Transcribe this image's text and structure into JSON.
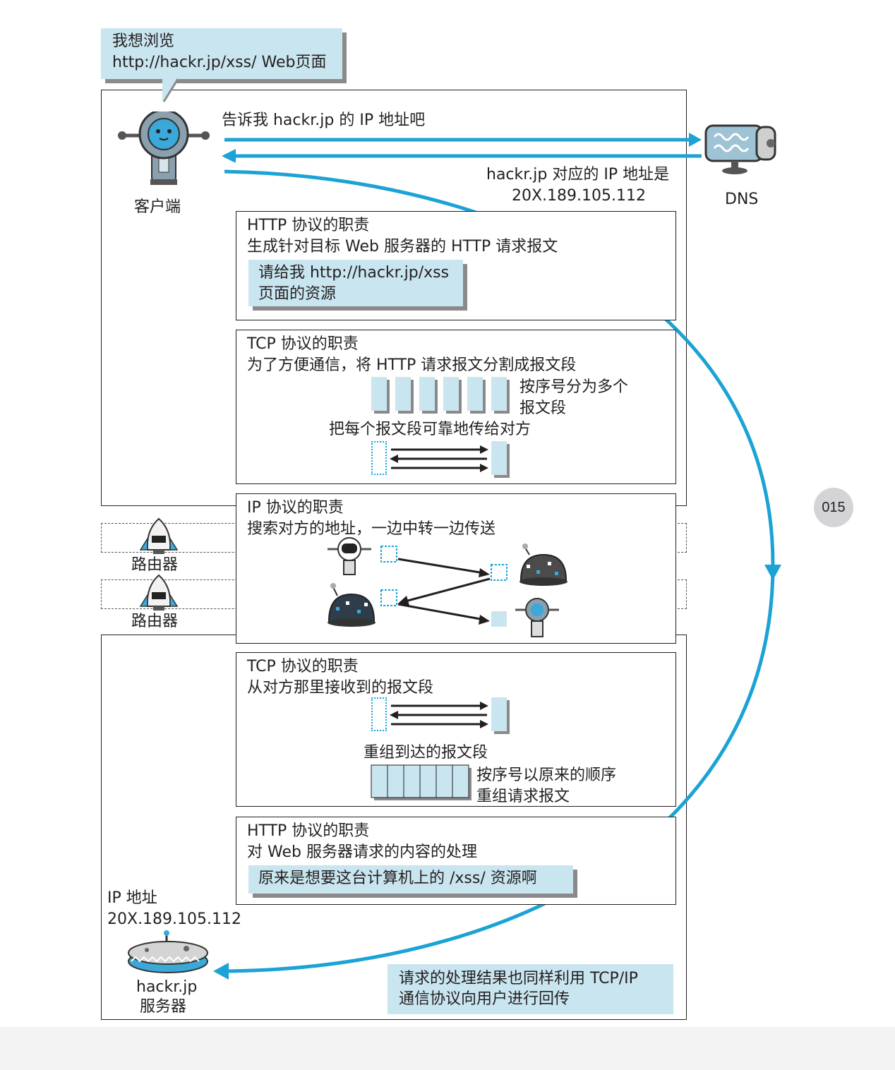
{
  "bubble": {
    "line1": "我想浏览",
    "line2": "http://hackr.jp/xss/ Web页面"
  },
  "client": {
    "label": "客户端"
  },
  "dns": {
    "label": "DNS",
    "query": "告诉我 hackr.jp 的 IP 地址吧",
    "answer_line1": "hackr.jp 对应的 IP 地址是",
    "answer_line2": "20X.189.105.112"
  },
  "http_client": {
    "title": "HTTP 协议的职责",
    "desc": "生成针对目标 Web 服务器的 HTTP 请求报文",
    "note_line1": "请给我 http://hackr.jp/xss",
    "note_line2": "页面的资源"
  },
  "tcp_client": {
    "title": "TCP 协议的职责",
    "desc": "为了方便通信，将 HTTP 请求报文分割成报文段",
    "split_line1": "按序号分为多个",
    "split_line2": "报文段",
    "reliable": "把每个报文段可靠地传给对方"
  },
  "ip": {
    "title": "IP 协议的职责",
    "desc": "搜索对方的地址，一边中转一边传送"
  },
  "routers": [
    "路由器",
    "路由器"
  ],
  "tcp_server": {
    "title": "TCP 协议的职责",
    "desc": "从对方那里接收到的报文段",
    "reassemble": "重组到达的报文段",
    "order_line1": "按序号以原来的顺序",
    "order_line2": "重组请求报文"
  },
  "http_server": {
    "title": "HTTP 协议的职责",
    "desc": "对 Web 服务器请求的内容的处理",
    "note": "原来是想要这台计算机上的 /xss/ 资源啊"
  },
  "server": {
    "ip_label": "IP 地址",
    "ip_value": "20X.189.105.112",
    "name_line1": "hackr.jp",
    "name_line2": "服务器"
  },
  "result_note": {
    "line1": "请求的处理结果也同样利用 TCP/IP",
    "line2": "通信协议向用户进行回传"
  },
  "page_number": "015",
  "colors": {
    "arrow": "#1aa3d4",
    "note_fill": "#c9e5ef",
    "shadow": "#8a8a8a"
  }
}
